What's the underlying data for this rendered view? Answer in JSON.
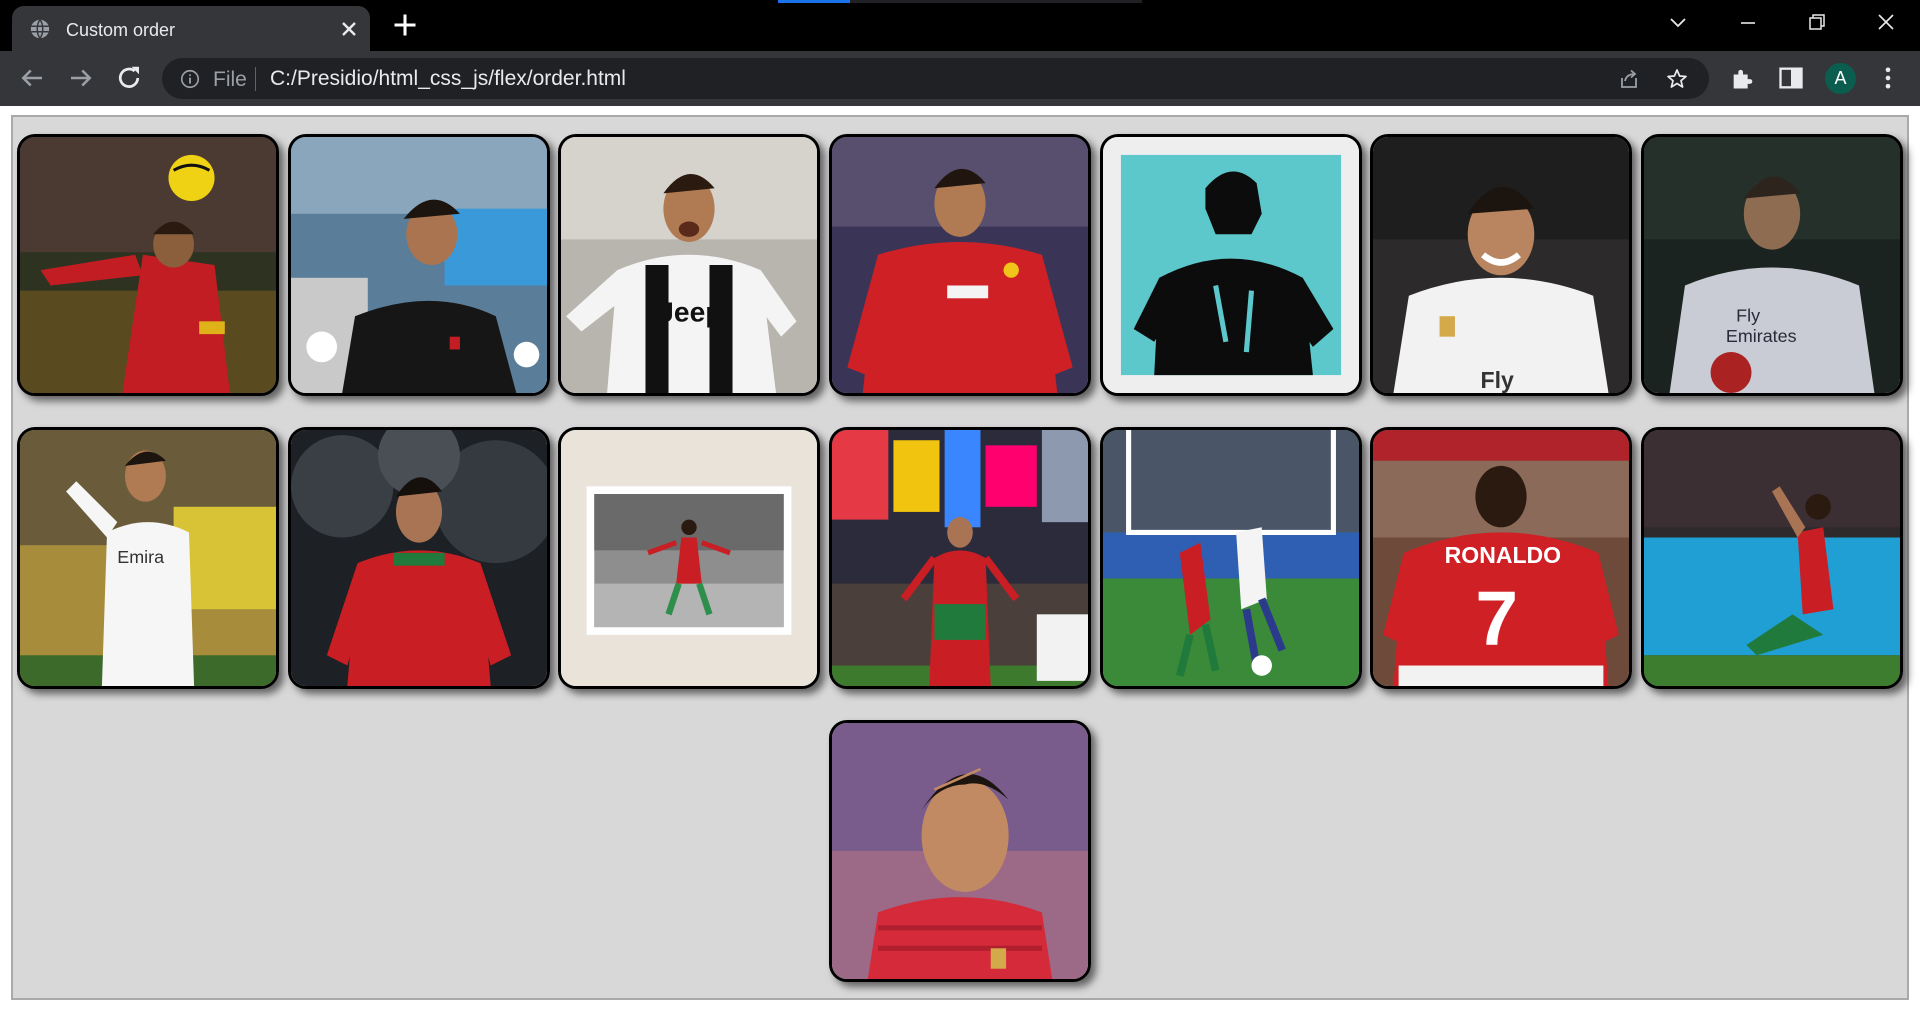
{
  "browser": {
    "tab_title": "Custom order",
    "url_scheme": "File",
    "url": "C:/Presidio/html_css_js/flex/order.html",
    "profile_initial": "A"
  },
  "colors": {
    "page_background": "#d9d8d9",
    "card_border": "#000000",
    "chrome_dark": "#35363a",
    "accent": "#1a73e8"
  },
  "icons": [
    "globe-icon",
    "close-icon",
    "plus-icon",
    "chevron-down-icon",
    "minimize-icon",
    "restore-icon",
    "window-close-icon",
    "back-arrow-icon",
    "forward-arrow-icon",
    "reload-icon",
    "info-icon",
    "share-icon",
    "star-icon",
    "extensions-icon",
    "side-panel-icon",
    "kebab-menu-icon"
  ],
  "gallery": {
    "rows": [
      [
        "ronaldo-red-kit-heading-ball",
        "ronaldo-black-training-shirt",
        "ronaldo-juventus-jeep-kit",
        "ronaldo-manchester-united-red",
        "ronaldo-teal-stencil-art",
        "ronaldo-real-madrid-white-smiling"
      ],
      [
        "ronaldo-dark-real-madrid-portrait",
        "ronaldo-real-madrid-pointing",
        "ronaldo-portugal-dark-clouds",
        "ronaldo-framed-celebration-pose",
        "ronaldo-portugal-city-billboards",
        "ronaldo-portugal-vs-france-match"
      ],
      [
        "ronaldo-manchester-united-number-7-back",
        "ronaldo-kneeling-prayer",
        "ronaldo-portugal-headshot"
      ]
    ]
  }
}
